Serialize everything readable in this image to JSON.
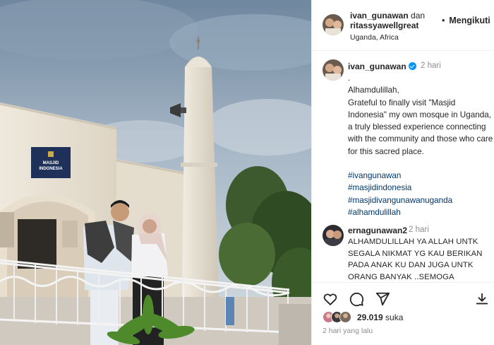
{
  "post": {
    "image_signage": "MASJID INDONESIA"
  },
  "header": {
    "user1": "ivan_gunawan",
    "connector": "dan",
    "user2": "ritassyawellgreat",
    "location": "Uganda, Africa",
    "dot": "•",
    "follow_label": "Mengikuti"
  },
  "caption": {
    "username": "ivan_gunawan",
    "time": "2 hari",
    "lines": [
      ".",
      "Alhamdulillah,",
      "Grateful to finally visit \"Masjid Indonesia\" my own mosque in Uganda, a truly blessed experience connecting with the community and those who care for this sacred place."
    ],
    "hashtags": [
      "#ivangunawan",
      "#masjidindonesia",
      "#masjidivangunawanuganda",
      "#alhamdulillah"
    ]
  },
  "comment": {
    "username": "ernagunawan2",
    "time": "2 hari",
    "text": "ALHAMDULILLAH YA ALLAH UNTK SEGALA NIKMAT YG KAU BERIKAN PADA ANAK KU DAN JUGA UNTK ORANG BANYAK ..SEMOGA"
  },
  "actions": {
    "likes_count": "29.019",
    "likes_suffix": "suka",
    "posted_ago": "2 hari yang lalu"
  },
  "icons": [
    "heart-icon",
    "comment-icon",
    "share-icon",
    "bookmark-icon",
    "verified-badge-icon"
  ],
  "colors": {
    "text": "#262626",
    "muted": "#8e8e8e",
    "hashtag": "#00376b",
    "verified": "#0095f6",
    "divider": "#efefef"
  }
}
